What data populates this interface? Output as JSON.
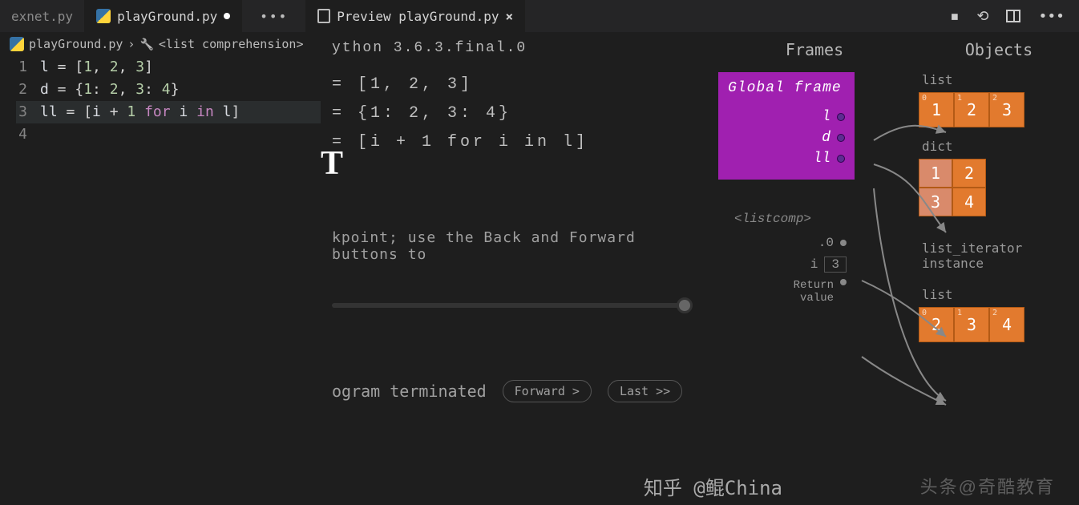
{
  "tabs": {
    "inactive": "exnet.py",
    "active": "playGround.py",
    "preview": "Preview playGround.py"
  },
  "breadcrumb": {
    "file": "playGround.py",
    "symbol": "<list comprehension>"
  },
  "editor": {
    "lines": [
      {
        "n": "1",
        "html": "l = [1, 2, 3]"
      },
      {
        "n": "2",
        "html": "d = {1: 2, 3: 4}"
      },
      {
        "n": "3",
        "html": "ll = [i + 1 for i in l]"
      },
      {
        "n": "4",
        "html": ""
      }
    ]
  },
  "preview": {
    "header": "ython 3.6.3.final.0",
    "lines": [
      "= [1, 2, 3]",
      "= {1: 2, 3: 4}",
      "= [i + 1 for i in l]"
    ],
    "hint": "kpoint; use the Back and Forward buttons to",
    "terminated": "ogram terminated",
    "forward": "Forward >",
    "last": "Last >>"
  },
  "frames": {
    "title": "Frames",
    "global": "Global frame",
    "vars": [
      "l",
      "d",
      "ll"
    ],
    "listcomp": "<listcomp>",
    "lc_rows": [
      {
        "k": ".0",
        "v": ""
      },
      {
        "k": "i",
        "v": "3"
      },
      {
        "k": "Return\nvalue",
        "v": ""
      }
    ]
  },
  "objects": {
    "title": "Objects",
    "list1": {
      "label": "list",
      "cells": [
        "1",
        "2",
        "3"
      ]
    },
    "dict": {
      "label": "dict",
      "pairs": [
        [
          "1",
          "2"
        ],
        [
          "3",
          "4"
        ]
      ]
    },
    "iter": "list_iterator\ninstance",
    "list2": {
      "label": "list",
      "cells": [
        "2",
        "3",
        "4"
      ]
    }
  },
  "watermark": "头条@奇酷教育",
  "watermark2": "知乎 @鲲China"
}
